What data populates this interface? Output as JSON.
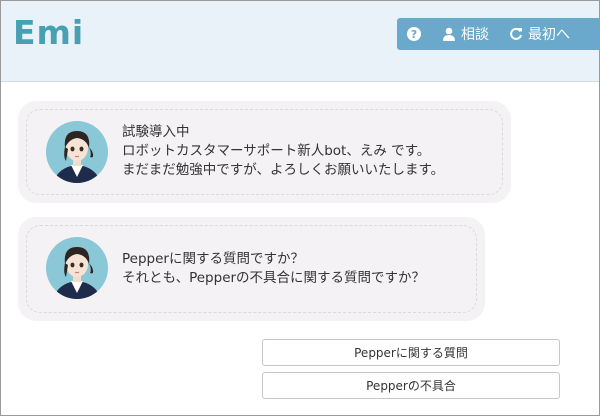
{
  "header": {
    "logo": "Emi",
    "toolbar": {
      "help_icon": "question-circle-icon",
      "consult_icon": "user-icon",
      "consult_label": "相談",
      "reset_icon": "refresh-icon",
      "reset_label": "最初へ"
    }
  },
  "chat": {
    "messages": [
      {
        "avatar": "bot-avatar",
        "lines": [
          "試験導入中",
          "ロボットカスタマーサポート新人bot、えみ です。",
          "まだまだ勉強中ですが、よろしくお願いいたします。"
        ]
      },
      {
        "avatar": "bot-avatar",
        "lines": [
          "Pepperに関する質問ですか？",
          "それとも、Pepperの不具合に関する質問ですか？"
        ]
      }
    ],
    "choices": [
      "Pepperに関する質問",
      "Pepperの不具合"
    ]
  },
  "colors": {
    "logo": "#4aa0b3",
    "header_bg": "#e9f2f8",
    "toolbar_bg": "#6ba9cc",
    "bubble_bg": "#f4f2f5"
  }
}
